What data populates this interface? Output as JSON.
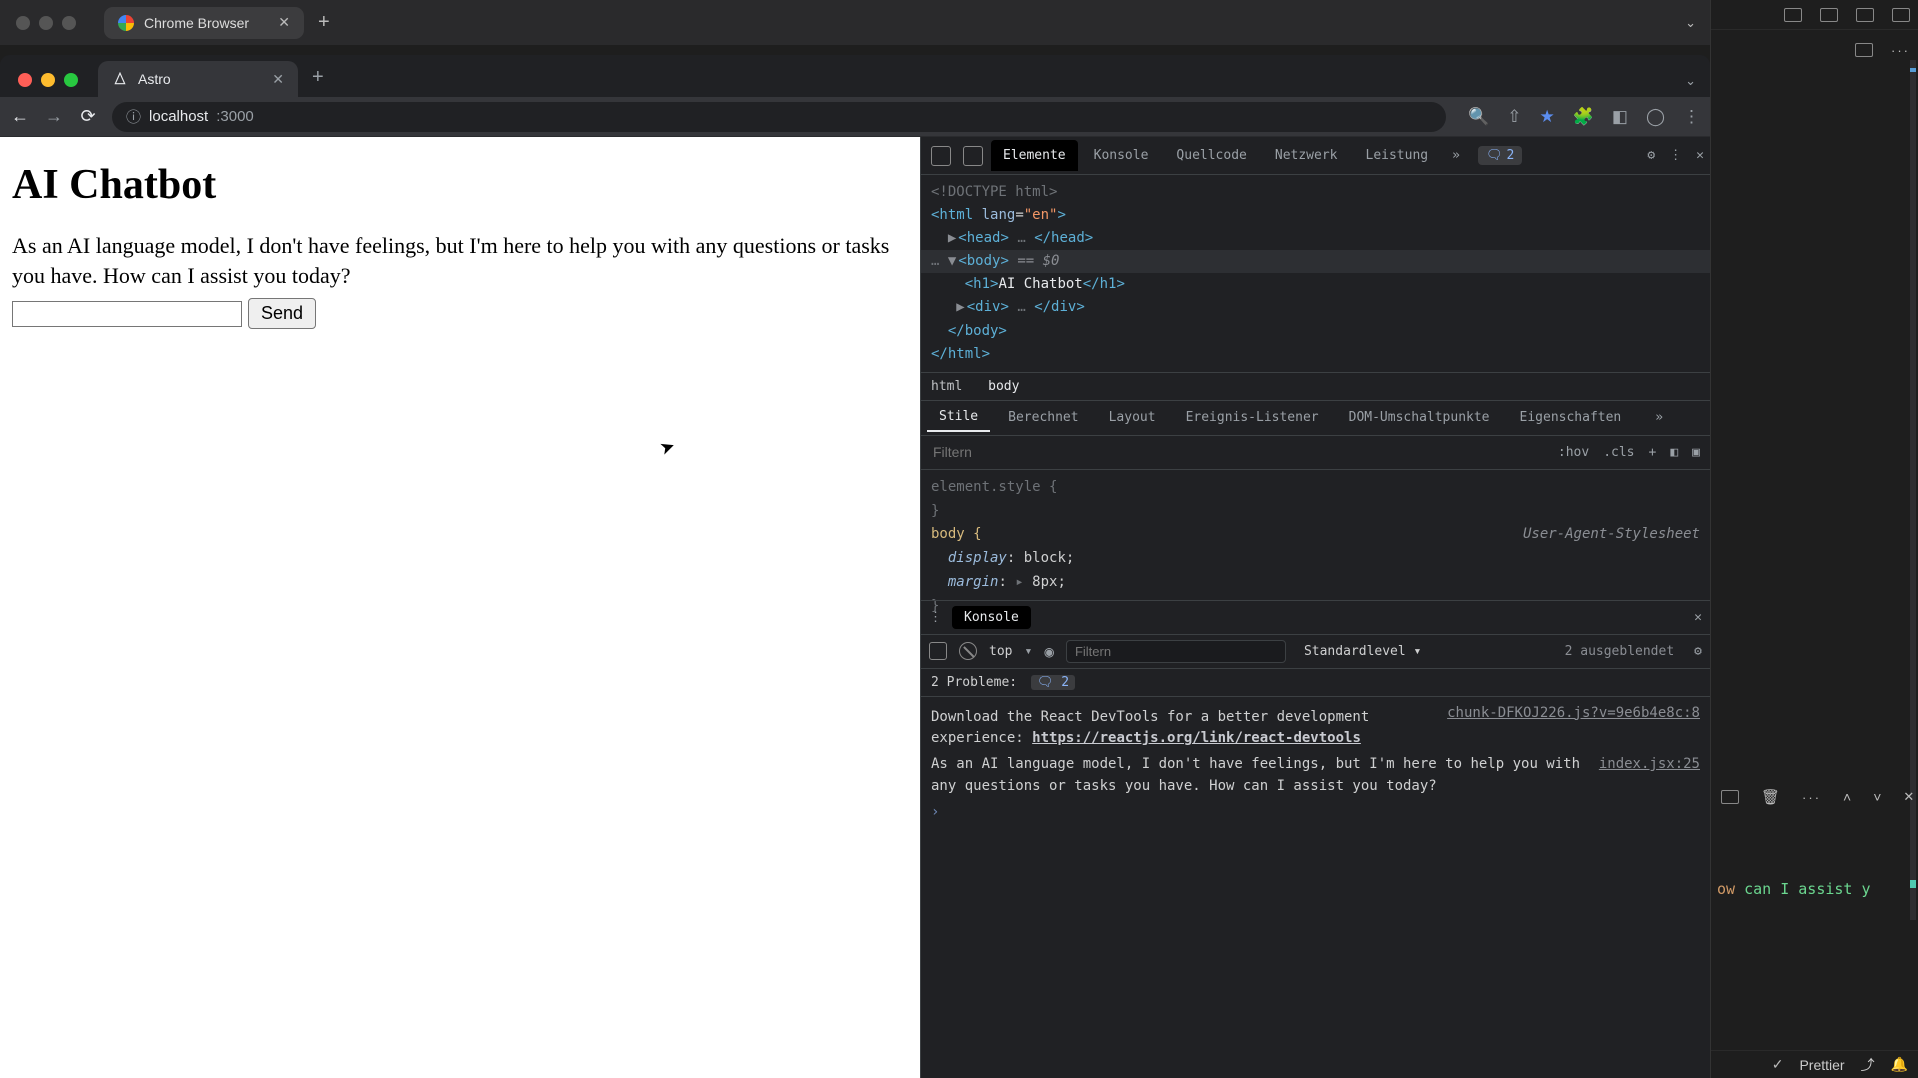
{
  "outer": {
    "tab_title": "Chrome Browser",
    "chevron": "⌄"
  },
  "chrome": {
    "tab_title": "Astro",
    "omnibox_host": "localhost",
    "omnibox_path": ":3000"
  },
  "page": {
    "h1": "AI Chatbot",
    "response": "As an AI language model, I don't have feelings, but I'm here to help you with any questions or tasks you have. How can I assist you today?",
    "input_value": "",
    "send_label": "Send"
  },
  "devtools": {
    "tabs": {
      "elements": "Elemente",
      "console": "Konsole",
      "sources": "Quellcode",
      "network": "Netzwerk",
      "performance": "Leistung"
    },
    "issue_count": "2",
    "elements_text": "AI Chatbot",
    "breadcrumb": {
      "a": "html",
      "b": "body"
    },
    "styles_tabs": {
      "styles": "Stile",
      "computed": "Berechnet",
      "layout": "Layout",
      "listeners": "Ereignis-Listener",
      "dom_bp": "DOM-Umschaltpunkte",
      "props": "Eigenschaften"
    },
    "filter_placeholder": "Filtern",
    "hov": ":hov",
    "cls": ".cls",
    "style_block": {
      "element_style": "element.style {",
      "body_sel": "body {",
      "uas": "User-Agent-Stylesheet",
      "p1k": "display",
      "p1v": "block;",
      "p2k": "margin",
      "p2v": "8px;"
    },
    "drawer": {
      "tab": "Konsole",
      "context": "top",
      "filter_placeholder": "Filtern",
      "levels": "Standardlevel",
      "hidden": "2 ausgeblendet",
      "problems_label": "2 Probleme:",
      "problems_count": "2",
      "src1": "chunk-DFKOJ226.js?v=9e6b4e8c:8",
      "line1a": "Download the React DevTools for a better development experience: ",
      "line1b": "https://reactjs.org/link/react-devtools",
      "src2": "index.jsx:25",
      "line2": "As an AI language model, I don't have feelings, but I'm here to help you with any questions or tasks you have. How can I assist you today?"
    }
  },
  "vscode": {
    "term_fragment_a": "ow ",
    "term_fragment_b": "can I assist y",
    "status_prettier": "Prettier"
  }
}
